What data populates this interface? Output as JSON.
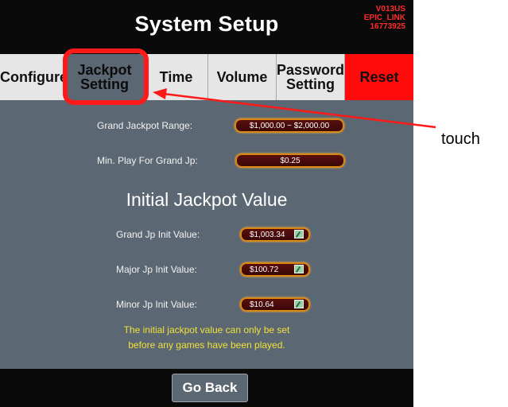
{
  "header": {
    "title": "System Setup",
    "version_lines": [
      "V013US",
      "EPIC_LINK",
      "16773925"
    ]
  },
  "tabs": [
    {
      "label": "Configure"
    },
    {
      "label": "Jackpot Setting",
      "active": true
    },
    {
      "label": "Time"
    },
    {
      "label": "Volume"
    },
    {
      "label": "Password Setting"
    },
    {
      "label": "Reset"
    }
  ],
  "settings": {
    "grand_jackpot_range": {
      "label": "Grand Jackpot Range:",
      "value": "$1,000.00 ~ $2,000.00"
    },
    "min_play_grand_jp": {
      "label": "Min. Play For Grand Jp:",
      "value": "$0.25"
    }
  },
  "initial_jackpot": {
    "title": "Initial Jackpot Value",
    "grand": {
      "label": "Grand Jp Init Value:",
      "value": "$1,003.34"
    },
    "major": {
      "label": "Major Jp Init Value:",
      "value": "$100.72"
    },
    "minor": {
      "label": "Minor Jp Init Value:",
      "value": "$10.64"
    }
  },
  "note": {
    "line1": "The initial jackpot value can only be set",
    "line2": "before any games have been played."
  },
  "footer": {
    "go_back": "Go Back"
  },
  "annotation": {
    "label": "touch",
    "color": "#ff1a1a"
  },
  "colors": {
    "panel": "#5b6772",
    "reset": "#ff0b0b",
    "note": "#f1e13a",
    "pill_border": "#d98a12"
  }
}
